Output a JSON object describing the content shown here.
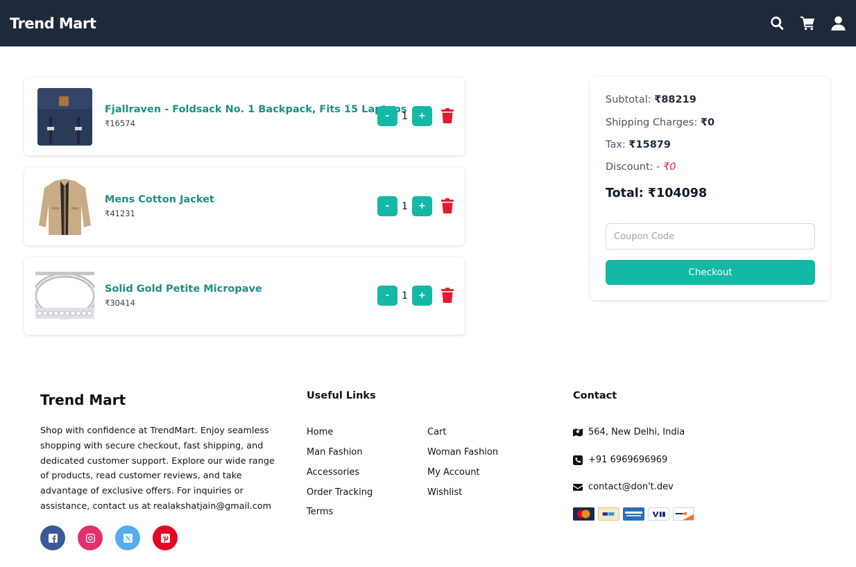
{
  "header": {
    "brand": "Trend Mart",
    "icons": [
      "search-icon",
      "cart-icon",
      "user-icon"
    ]
  },
  "cart": {
    "items": [
      {
        "name": "Fjallraven - Foldsack No. 1 Backpack, Fits 15 Laptops",
        "price": "₹16574",
        "quantity": "1",
        "decrement": "-",
        "increment": "+",
        "image": "backpack"
      },
      {
        "name": "Mens Cotton Jacket",
        "price": "₹41231",
        "quantity": "1",
        "decrement": "-",
        "increment": "+",
        "image": "jacket"
      },
      {
        "name": "Solid Gold Petite Micropave",
        "price": "₹30414",
        "quantity": "1",
        "decrement": "-",
        "increment": "+",
        "image": "ring"
      }
    ]
  },
  "summary": {
    "subtotal_label": "Subtotal:",
    "subtotal_value": "₹88219",
    "shipping_label": "Shipping Charges:",
    "shipping_value": "₹0",
    "tax_label": "Tax:",
    "tax_value": "₹15879",
    "discount_label": "Discount:",
    "discount_value": "- ₹0",
    "total_label": "Total:",
    "total_value": "₹104098",
    "coupon_placeholder": "Coupon Code",
    "checkout_label": "Checkout"
  },
  "footer": {
    "brand": "Trend Mart",
    "about": "Shop with confidence at TrendMart. Enjoy seamless shopping with secure checkout, fast shipping, and dedicated customer support. Explore our wide range of products, read customer reviews, and take advantage of exclusive offers. For inquiries or assistance, contact us at realakshatjain@gmail.com",
    "socials": [
      {
        "name": "facebook",
        "color": "#3b5998"
      },
      {
        "name": "instagram",
        "color": "#e1306c"
      },
      {
        "name": "x",
        "color": "#55acee"
      },
      {
        "name": "pinterest",
        "color": "#e60023"
      }
    ],
    "useful_links_heading": "Useful Links",
    "links_col1": [
      "Home",
      "Man Fashion",
      "Accessories",
      "Order Tracking",
      "Terms"
    ],
    "links_col2": [
      "Cart",
      "Woman Fashion",
      "My Account",
      "Wishlist"
    ],
    "contact_heading": "Contact",
    "contact": {
      "address": "564, New Delhi, India",
      "phone": "+91 6969696969",
      "email": "contact@don't.dev"
    },
    "payments": [
      "mastercard",
      "paypal",
      "american-express",
      "visa",
      "discover"
    ]
  },
  "colors": {
    "header_bg": "#1e293b",
    "accent": "#14b8a6",
    "product_name": "#1c8f82",
    "delete": "#e11d2d",
    "discount": "#dc2626"
  }
}
